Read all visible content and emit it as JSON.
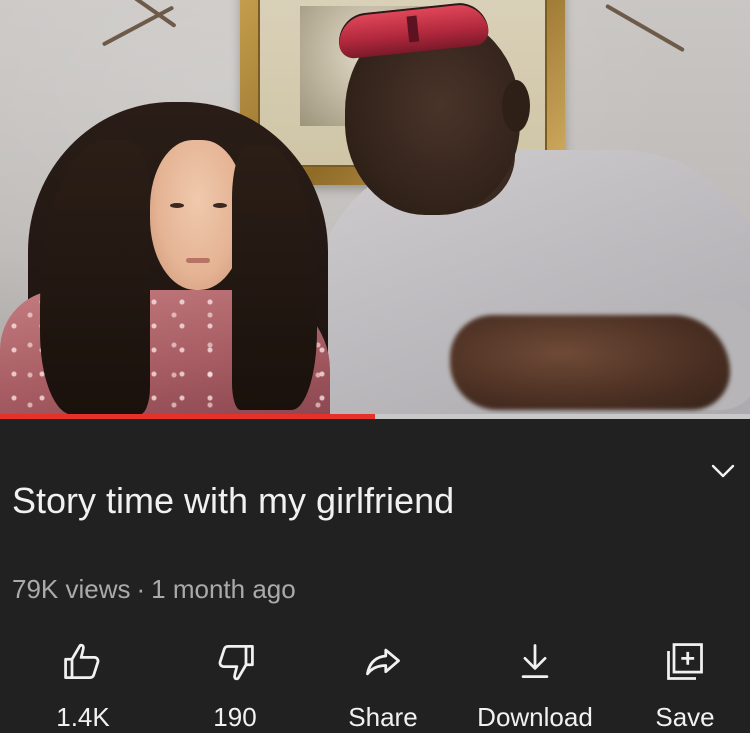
{
  "video": {
    "progress_fraction": 0.5
  },
  "details": {
    "title": "Story time with my girlfriend",
    "views": "79K views",
    "separator": "·",
    "age": "1 month ago"
  },
  "actions": [
    {
      "icon": "thumbs-up-icon",
      "label": "1.4K"
    },
    {
      "icon": "thumbs-down-icon",
      "label": "190"
    },
    {
      "icon": "share-icon",
      "label": "Share"
    },
    {
      "icon": "download-icon",
      "label": "Download"
    },
    {
      "icon": "save-icon",
      "label": "Save"
    }
  ],
  "header": {
    "expand_icon": "chevron-down-icon"
  },
  "colors": {
    "background": "#212121",
    "text_primary": "#f1f1f1",
    "text_secondary": "#aaaaaa",
    "progress": "#e6302a",
    "progress_track": "#c8c8c8"
  }
}
